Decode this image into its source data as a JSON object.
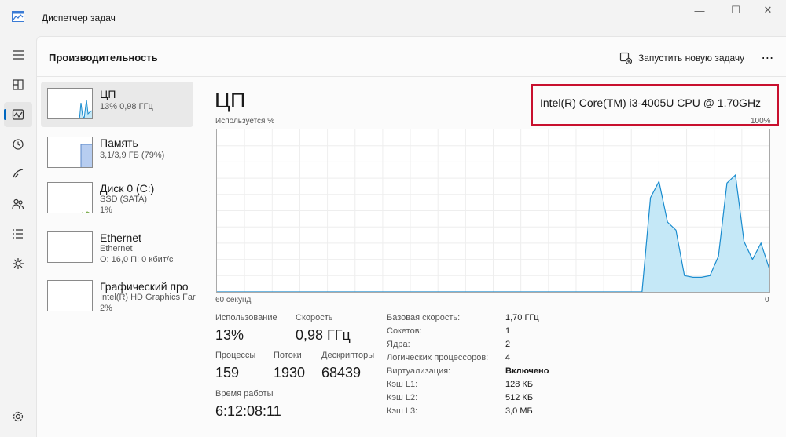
{
  "app": {
    "title": "Диспетчер задач"
  },
  "window_controls": {
    "minimize": "—",
    "maximize": "☐",
    "close": "✕"
  },
  "nav": {
    "items": [
      {
        "icon": "hamburger-menu-icon"
      },
      {
        "icon": "processes-icon"
      },
      {
        "icon": "performance-icon",
        "active": true
      },
      {
        "icon": "app-history-icon"
      },
      {
        "icon": "startup-apps-icon"
      },
      {
        "icon": "users-icon"
      },
      {
        "icon": "details-icon"
      },
      {
        "icon": "services-icon"
      },
      {
        "icon": "settings-icon"
      }
    ]
  },
  "header": {
    "title": "Производительность",
    "run_task": "Запустить новую задачу",
    "more": "⋯"
  },
  "devices": [
    {
      "name": "ЦП",
      "sub1": "13% 0,98 ГГц",
      "sub2": "",
      "selected": true,
      "usage": 0.13
    },
    {
      "name": "Память",
      "sub1": "3,1/3,9 ГБ (79%)",
      "sub2": "",
      "usage": 0.79
    },
    {
      "name": "Диск 0 (C:)",
      "sub1": "SSD (SATA)",
      "sub2": "1%",
      "usage": 0.01
    },
    {
      "name": "Ethernet",
      "sub1": "Ethernet",
      "sub2": "О: 16,0 П: 0 кбит/с",
      "usage": 0.0
    },
    {
      "name": "Графический про",
      "sub1": "Intel(R) HD Graphics Far",
      "sub2": "2%",
      "usage": 0.02
    }
  ],
  "detail": {
    "title": "ЦП",
    "model": "Intel(R) Core(TM) i3-4005U CPU @ 1.70GHz",
    "highlight_color": "#c8102e",
    "graph": {
      "label_top_left": "Используется %",
      "label_top_right": "100%",
      "label_bottom_left": "60 секунд",
      "label_bottom_right": "0",
      "fill_color": "#c5e8f7",
      "line_color": "#1a8ccf",
      "usage_history": [
        0,
        0,
        0,
        0,
        0,
        0,
        0,
        0,
        0,
        0,
        0,
        0,
        0,
        0,
        0,
        0,
        0,
        0,
        0,
        0,
        0,
        0,
        0,
        0,
        0,
        0,
        0,
        0,
        0,
        0,
        0,
        0,
        0,
        0,
        0,
        0,
        0,
        0,
        0,
        0,
        0,
        0,
        0,
        0,
        0,
        0,
        0,
        0,
        0,
        0,
        0,
        0.58,
        0.68,
        0.43,
        0.38,
        0.1,
        0.09,
        0.09,
        0.1,
        0.22,
        0.67,
        0.72,
        0.31,
        0.2,
        0.3,
        0.14
      ]
    },
    "stats": {
      "usage_label": "Использование",
      "usage_value": "13%",
      "speed_label": "Скорость",
      "speed_value": "0,98 ГГц",
      "processes_label": "Процессы",
      "processes_value": "159",
      "threads_label": "Потоки",
      "threads_value": "1930",
      "handles_label": "Дескрипторы",
      "handles_value": "68439",
      "uptime_label": "Время работы",
      "uptime_value": "6:12:08:11"
    },
    "specs": [
      {
        "label": "Базовая скорость:",
        "value": "1,70 ГГц"
      },
      {
        "label": "Сокетов:",
        "value": "1"
      },
      {
        "label": "Ядра:",
        "value": "2"
      },
      {
        "label": "Логических процессоров:",
        "value": "4"
      },
      {
        "label": "Виртуализация:",
        "value": "Включено",
        "bold": true
      },
      {
        "label": "Кэш L1:",
        "value": "128 КБ"
      },
      {
        "label": "Кэш L2:",
        "value": "512 КБ"
      },
      {
        "label": "Кэш L3:",
        "value": "3,0 МБ"
      }
    ]
  }
}
